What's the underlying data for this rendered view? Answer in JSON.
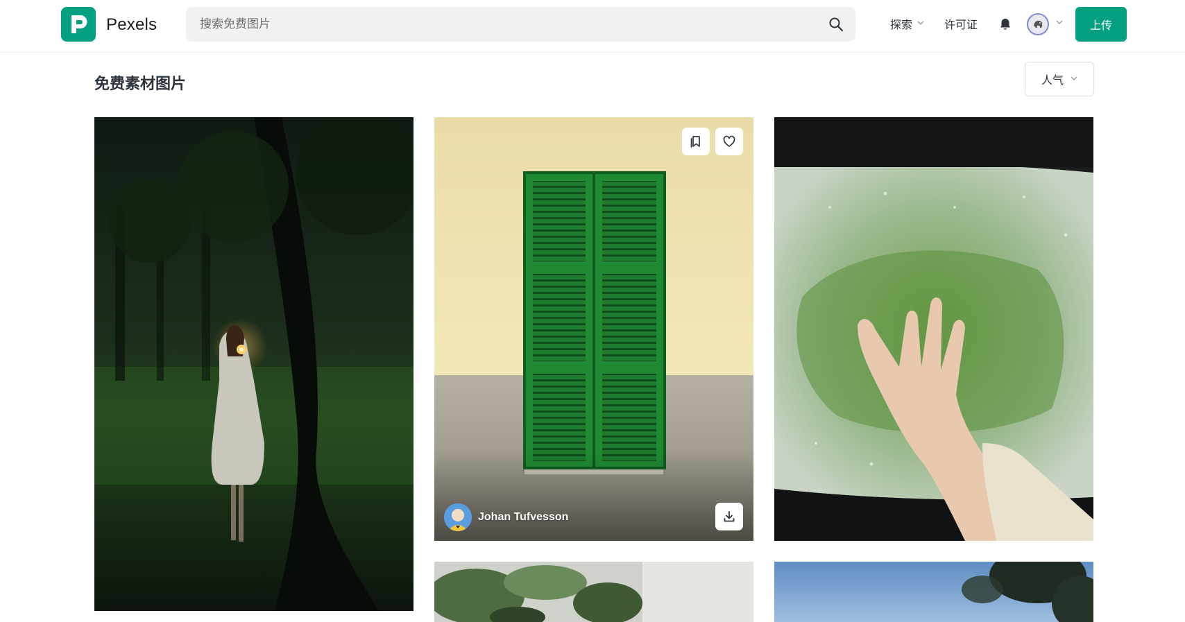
{
  "header": {
    "brand": "Pexels",
    "search": {
      "placeholder": "搜索免费图片"
    },
    "nav": {
      "explore": "探索",
      "license": "许可证"
    },
    "upload": "上传"
  },
  "page": {
    "title": "免费素材图片",
    "sort": "人气"
  },
  "photos": {
    "featured": {
      "photographer": "Johan Tufvesson"
    }
  },
  "colors": {
    "brand": "#05a081",
    "text": "#2c343e",
    "search_bg": "#f1f1f1"
  },
  "icons": [
    "search-icon",
    "chevron-down-icon",
    "bell-icon",
    "avatar-icon",
    "collect-icon",
    "heart-icon",
    "download-icon"
  ]
}
